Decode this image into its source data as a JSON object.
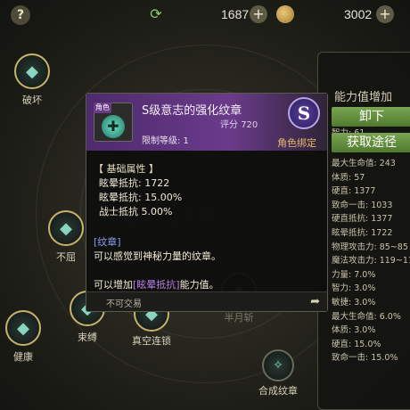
{
  "topbar": {
    "currency1": "1687",
    "currency2": "3002"
  },
  "nodes": [
    {
      "label": "破坏"
    },
    {
      "label": "不屈"
    },
    {
      "label": "束缚"
    },
    {
      "label": "真空连锁"
    },
    {
      "label": "半月斩"
    },
    {
      "label": "健康"
    },
    {
      "label": "合成纹章"
    }
  ],
  "tooltip": {
    "badge": "角色",
    "name": "S级意志的强化纹章",
    "score_label": "评分",
    "score": "720",
    "limit": "限制等级: 1",
    "grade": "S",
    "bind": "角色绑定",
    "basic_title": "【 基础属性 】",
    "basic_stats": [
      "眩晕抵抗: 1722",
      "眩晕抵抗: 15.00%",
      "战士抵抗 5.00%"
    ],
    "crest_title": "[纹章]",
    "desc1": "可以感觉到神秘力量的纹章。",
    "desc2_pre": "可以增加",
    "desc2_link": "[眩晕抵抗]",
    "desc2_post": "能力值。",
    "footer": "不可交易"
  },
  "panel": {
    "title": "能力值增加",
    "unequip": "卸下",
    "obtain": "获取途径",
    "partial_line": "智力: 61",
    "stats": [
      "最大生命值: 243",
      "体质: 57",
      "硬直: 1377",
      "致命一击: 1033",
      "硬直抵抗: 1377",
      "眩晕抵抗: 1722",
      "物理攻击力: 85~85",
      "魔法攻击力: 119~119",
      "力量: 7.0%",
      "智力: 3.0%",
      "敏捷: 3.0%",
      "最大生命值: 6.0%",
      "体质: 3.0%",
      "硬直: 15.0%",
      "致命一击: 15.0%"
    ]
  },
  "colors": {
    "header_purple": "#6a3b8a",
    "accent_gold": "#c7b36a",
    "button_green": "#6b9a46",
    "link_purple": "#b680e6"
  }
}
